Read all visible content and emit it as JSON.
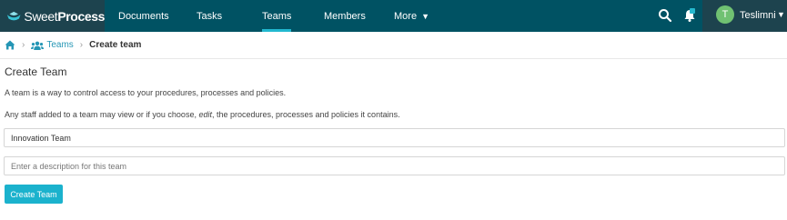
{
  "brand": {
    "name_part1": "Sweet",
    "name_part2": "Process"
  },
  "nav": {
    "documents": "Documents",
    "tasks": "Tasks",
    "teams": "Teams",
    "members": "Members",
    "more": "More"
  },
  "notifications": {
    "badge": ""
  },
  "user": {
    "initial": "T",
    "name": "Teslimni"
  },
  "breadcrumb": {
    "teams": "Teams",
    "current": "Create team"
  },
  "page": {
    "title": "Create Team",
    "description1": "A team is a way to control access to your procedures, processes and policies.",
    "description2_before": "Any staff added to a team may view or if you choose, ",
    "description2_em": "edit",
    "description2_after": ", the procedures, processes and policies it contains."
  },
  "form": {
    "name_value": "Innovation Team",
    "description_placeholder": "Enter a description for this team",
    "submit_label": "Create Team"
  },
  "colors": {
    "topbar": "#005263",
    "brand_bg": "#1d434e",
    "accent": "#22b8cf",
    "button": "#1bb2cd",
    "avatar": "#70c172",
    "link": "#2596b5"
  },
  "icons": [
    "sweetprocess-logo-icon",
    "search-icon",
    "bell-icon",
    "chevron-down-icon",
    "home-icon",
    "users-icon"
  ]
}
